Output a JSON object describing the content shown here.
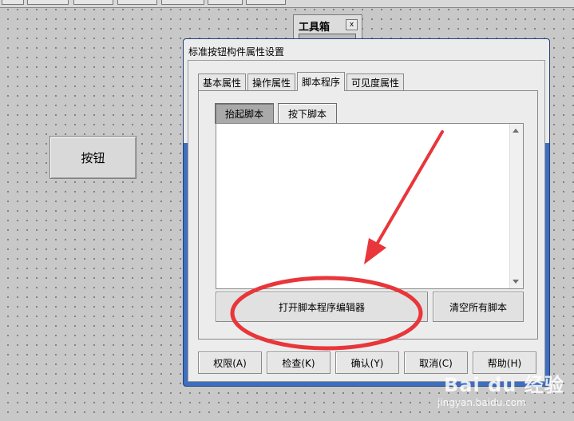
{
  "toolbox": {
    "title": "工具箱",
    "close_glyph": "x"
  },
  "canvas": {
    "button_label": "按钮"
  },
  "dialog": {
    "title": "标准按钮构件属性设置",
    "tabs": [
      {
        "label": "基本属性"
      },
      {
        "label": "操作属性"
      },
      {
        "label": "脚本程序"
      },
      {
        "label": "可见度属性"
      }
    ],
    "active_tab": "脚本程序",
    "subtabs": [
      {
        "label": "抬起脚本"
      },
      {
        "label": "按下脚本"
      }
    ],
    "script_text": "",
    "open_editor_label": "打开脚本程序编辑器",
    "clear_all_label": "清空所有脚本",
    "buttons": {
      "permission": "权限(A)",
      "check": "检查(K)",
      "confirm": "确认(Y)",
      "cancel": "取消(C)",
      "help": "帮助(H)"
    }
  },
  "annotation": {
    "color": "#e8363a"
  },
  "watermark": {
    "main": "Bai du 经验",
    "sub": "jingyan.baidu.com"
  }
}
